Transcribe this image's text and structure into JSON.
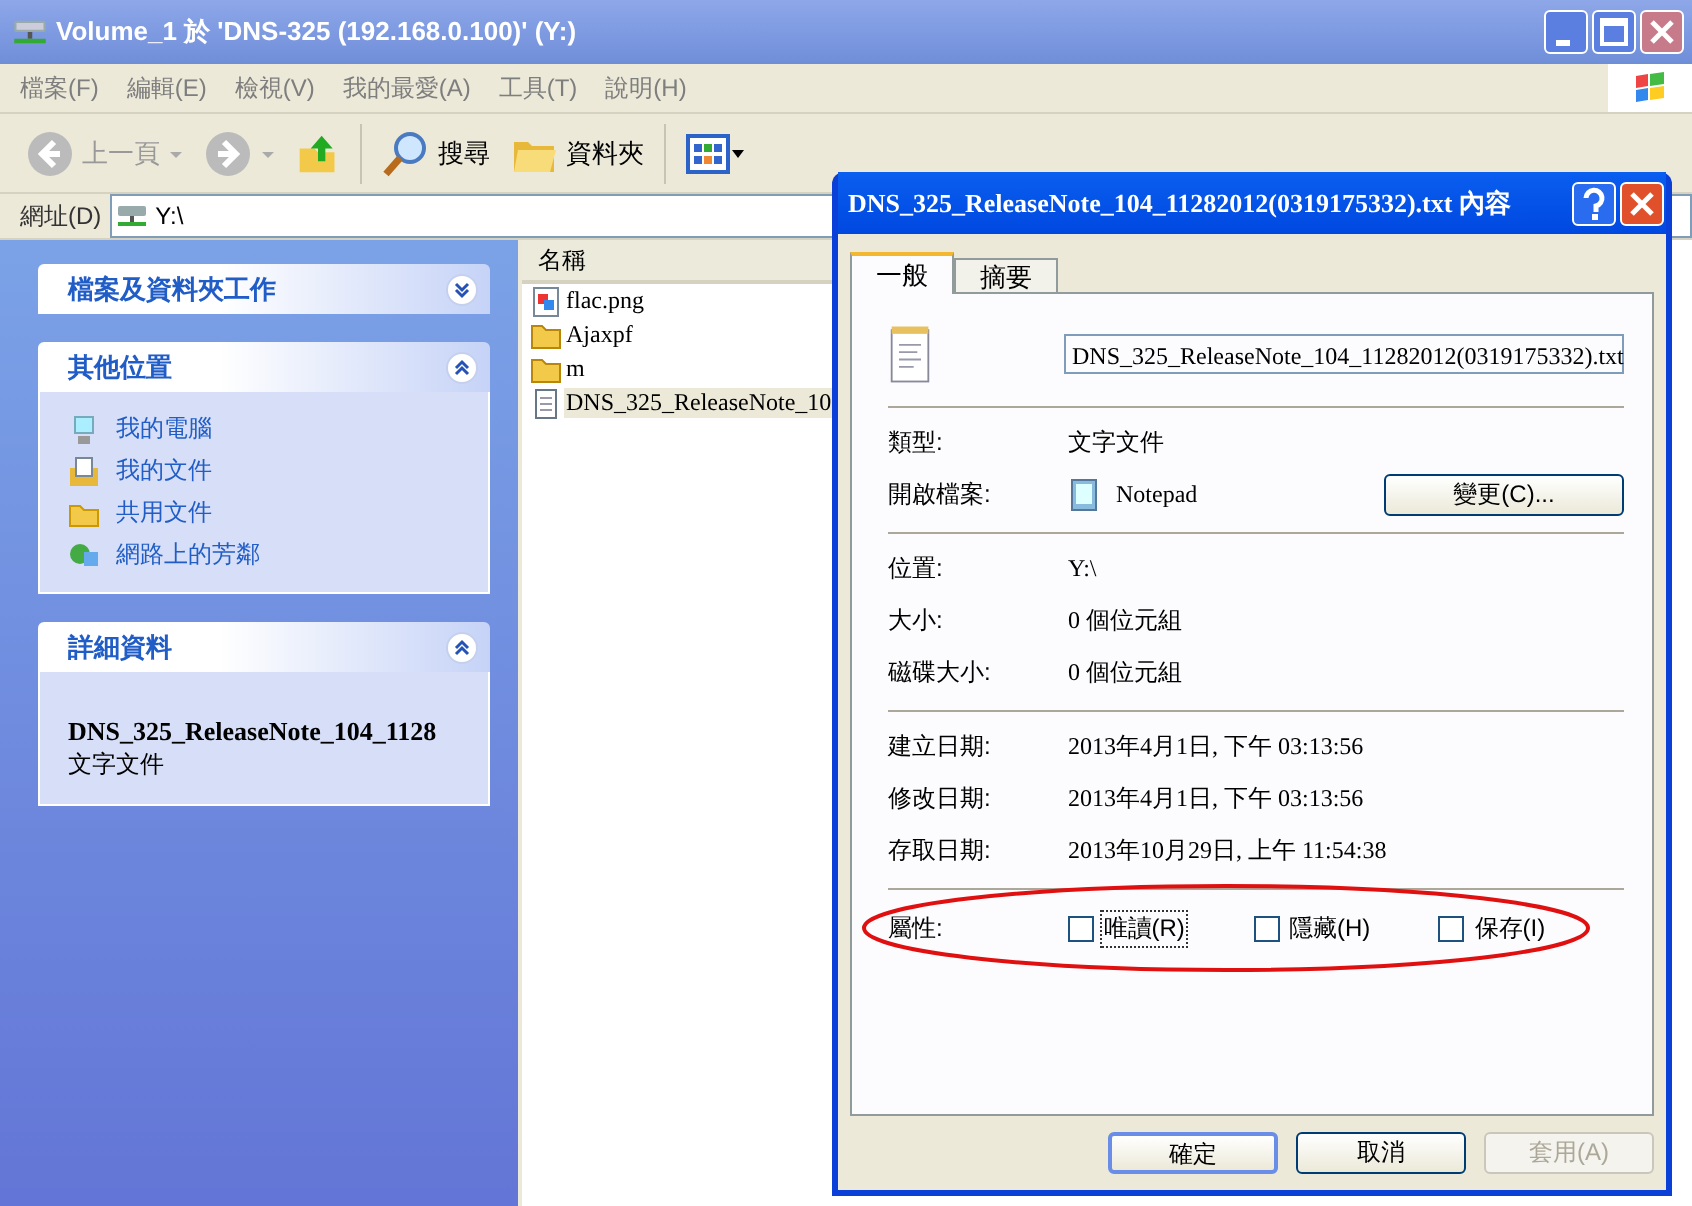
{
  "window": {
    "title": "Volume_1 於 'DNS-325 (192.168.0.100)' (Y:)"
  },
  "menu": [
    "檔案(F)",
    "編輯(E)",
    "檢視(V)",
    "我的最愛(A)",
    "工具(T)",
    "說明(H)"
  ],
  "toolbar": [
    {
      "kind": "back",
      "label": "上一頁",
      "disabled": true
    },
    {
      "kind": "forward",
      "disabled": true
    },
    {
      "kind": "up"
    },
    {
      "kind": "search",
      "label": "搜尋"
    },
    {
      "kind": "folders",
      "label": "資料夾"
    },
    {
      "kind": "views"
    }
  ],
  "address": {
    "label": "網址(D)",
    "value": "Y:\\"
  },
  "task_panes": [
    {
      "title": "檔案及資料夾工作",
      "expanded": false,
      "kind": "links"
    },
    {
      "title": "其他位置",
      "expanded": true,
      "kind": "links",
      "items": [
        {
          "label": "我的電腦"
        },
        {
          "label": "我的文件"
        },
        {
          "label": "共用文件"
        },
        {
          "label": "網路上的芳鄰"
        }
      ]
    },
    {
      "title": "詳細資料",
      "expanded": true,
      "kind": "details",
      "name": "DNS_325_ReleaseNote_104_1128",
      "type": "文字文件"
    }
  ],
  "file_list": {
    "column": "名稱",
    "files": [
      {
        "name": "flac.png",
        "kind": "image",
        "selected": false
      },
      {
        "name": "Ajaxpf",
        "kind": "folder",
        "selected": false
      },
      {
        "name": "m",
        "kind": "folder",
        "selected": false
      },
      {
        "name": "DNS_325_ReleaseNote_10",
        "kind": "text",
        "selected": true
      }
    ]
  },
  "dialog": {
    "title": "DNS_325_ReleaseNote_104_11282012(0319175332).txt 內容",
    "tabs": [
      {
        "label": "一般",
        "selected": true
      },
      {
        "label": "摘要",
        "selected": false
      }
    ],
    "file_name": "DNS_325_ReleaseNote_104_11282012(0319175332).txt",
    "type_label": "類型:",
    "type_value": "文字文件",
    "opens_label": "開啟檔案:",
    "opens_value": "Notepad",
    "change_button": "變更(C)...",
    "groups": [
      [
        {
          "label": "位置:",
          "value": "Y:\\"
        },
        {
          "label": "大小:",
          "value": "0 個位元組"
        },
        {
          "label": "磁碟大小:",
          "value": "0 個位元組"
        }
      ],
      [
        {
          "label": "建立日期:",
          "value": "2013年4月1日, 下午 03:13:56"
        },
        {
          "label": "修改日期:",
          "value": "2013年4月1日, 下午 03:13:56"
        },
        {
          "label": "存取日期:",
          "value": "2013年10月29日, 上午 11:54:38"
        }
      ]
    ],
    "attributes_label": "屬性:",
    "attributes": [
      {
        "label": "唯讀(R)",
        "checked": false,
        "focused": true
      },
      {
        "label": "隱藏(H)",
        "checked": false,
        "focused": false
      },
      {
        "label": "保存(I)",
        "checked": false,
        "focused": false
      }
    ],
    "attributes_highlighted": true,
    "buttons": [
      {
        "label": "確定",
        "disabled": false,
        "default": true
      },
      {
        "label": "取消",
        "disabled": false,
        "default": false
      },
      {
        "label": "套用(A)",
        "disabled": true,
        "default": false
      }
    ]
  }
}
